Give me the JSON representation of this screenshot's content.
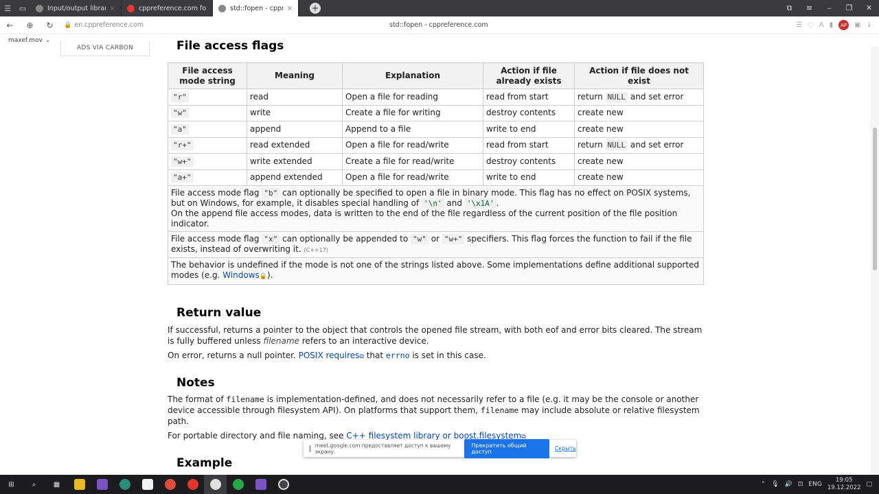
{
  "browser": {
    "tabs": [
      {
        "label": "Input/output library - cpp"
      },
      {
        "label": "cppreference.com fopen -"
      },
      {
        "label": "std::fopen - cppreferenc",
        "active": true
      }
    ],
    "url": "en.cppreference.com",
    "page_title": "std::fopen - cppreference.com",
    "user": "maxef.mov",
    "ext_badge": "AP"
  },
  "sidebar": {
    "ads_label": "ADS VIA CARBON"
  },
  "section_top": "File access flags",
  "table": {
    "headers": [
      "File access mode string",
      "Meaning",
      "Explanation",
      "Action if file already exists",
      "Action if file does not exist"
    ],
    "rows": [
      {
        "mode": "\"r\"",
        "meaning": "read",
        "explanation": "Open a file for reading",
        "exists": "read from start",
        "not_exists_pre": "return",
        "not_exists_code": "NULL",
        "not_exists_post": "and set error"
      },
      {
        "mode": "\"w\"",
        "meaning": "write",
        "explanation": "Create a file for writing",
        "exists": "destroy contents",
        "not_exists_pre": "create new",
        "not_exists_code": "",
        "not_exists_post": ""
      },
      {
        "mode": "\"a\"",
        "meaning": "append",
        "explanation": "Append to a file",
        "exists": "write to end",
        "not_exists_pre": "create new",
        "not_exists_code": "",
        "not_exists_post": ""
      },
      {
        "mode": "\"r+\"",
        "meaning": "read extended",
        "explanation": "Open a file for read/write",
        "exists": "read from start",
        "not_exists_pre": "return",
        "not_exists_code": "NULL",
        "not_exists_post": "and set error"
      },
      {
        "mode": "\"w+\"",
        "meaning": "write extended",
        "explanation": "Create a file for read/write",
        "exists": "destroy contents",
        "not_exists_pre": "create new",
        "not_exists_code": "",
        "not_exists_post": ""
      },
      {
        "mode": "\"a+\"",
        "meaning": "append extended",
        "explanation": "Open a file for read/write",
        "exists": "write to end",
        "not_exists_pre": "create new",
        "not_exists_code": "",
        "not_exists_post": ""
      }
    ],
    "note1": {
      "a": "File access mode flag",
      "b_code": "\"b\"",
      "c": "can optionally be specified to open a file in binary mode. This flag has no effect on POSIX systems, but on Windows, for example, it disables special handling of",
      "n_code": "'\\n'",
      "and": "and",
      "x1a_code": "'\\x1A'",
      "dot": ".",
      "d": "On the append file access modes, data is written to the end of the file regardless of the current position of the file position indicator."
    },
    "note2": {
      "a": "File access mode flag",
      "x_code": "\"x\"",
      "b": "can optionally be appended to",
      "w_code": "\"w\"",
      "or": "or",
      "wp_code": "\"w+\"",
      "c": "specifiers. This flag forces the function to fail if the file exists, instead of overwriting it.",
      "std": "(C++17)"
    },
    "note3": {
      "a": "The behavior is undefined if the mode is not one of the strings listed above. Some implementations define additional supported modes (e.g.",
      "link": "Windows",
      "b": ")."
    }
  },
  "return_value": {
    "heading": "Return value",
    "p1_a": "If successful, returns a pointer to the object that controls the opened file stream, with both eof and error bits cleared. The stream is fully buffered unless",
    "p1_ital": "filename",
    "p1_b": "refers to an interactive device.",
    "p2_a": "On error, returns a null pointer.",
    "p2_link": "POSIX requires",
    "p2_b": "that",
    "p2_code": "errno",
    "p2_c": "is set in this case."
  },
  "notes": {
    "heading": "Notes",
    "p1_a": "The format of",
    "p1_code": "filename",
    "p1_b": "is implementation-defined, and does not necessarily refer to a file (e.g. it may be the console or another device accessible through filesystem API). On platforms that support them,",
    "p1_code2": "filename",
    "p1_c": "may include absolute or relative filesystem path.",
    "p2_a": "For portable directory and file naming, see",
    "p2_link": "C++ filesystem library or boost.filesystem"
  },
  "example_heading": "Example",
  "share_bar": {
    "text": "meet.google.com предоставляет доступ к вашему экрану.",
    "stop": "Прекратить общий доступ",
    "hide": "Скрыть"
  },
  "taskbar": {
    "lang": "ENG",
    "time": "19:05",
    "date": "19.12.2022"
  }
}
